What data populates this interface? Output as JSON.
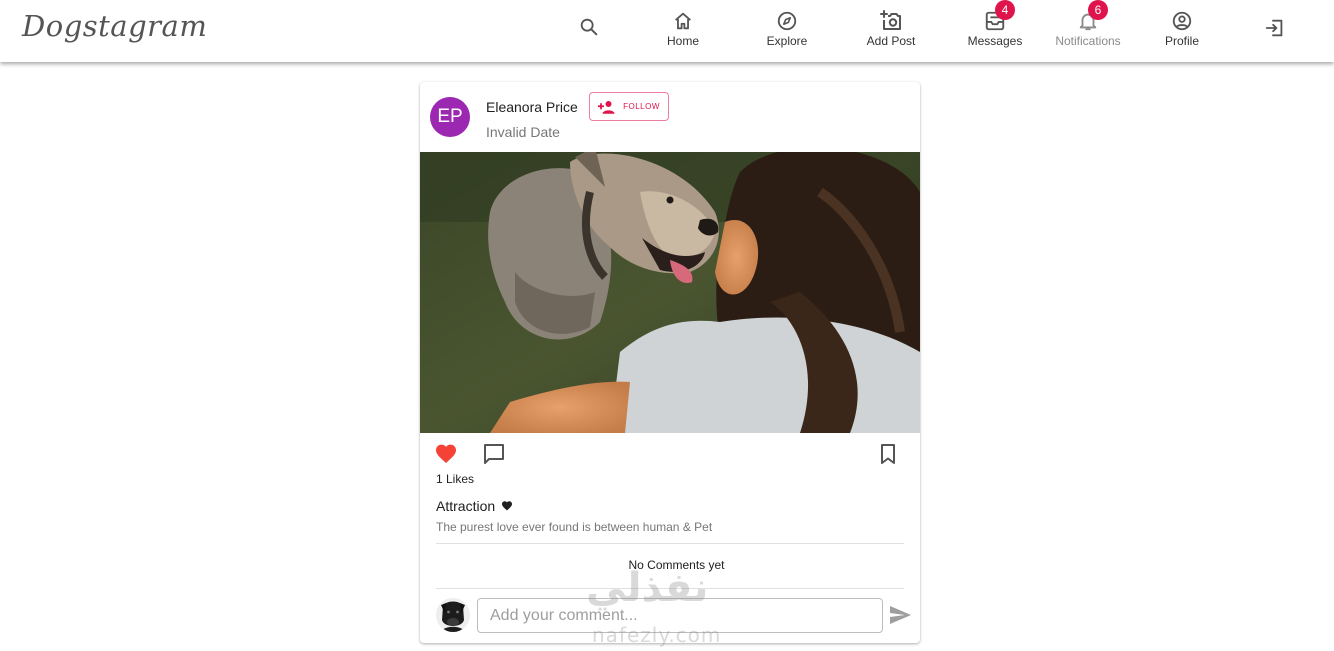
{
  "app": {
    "logo": "Dogstagram"
  },
  "nav": {
    "home": "Home",
    "explore": "Explore",
    "add_post": "Add Post",
    "messages": "Messages",
    "messages_badge": "4",
    "notifications": "Notifications",
    "notifications_badge": "6",
    "profile": "Profile"
  },
  "post": {
    "avatar_initials": "EP",
    "avatar_color": "#9c27b0",
    "author": "Eleanora Price",
    "follow_label": "FOLLOW",
    "date": "Invalid Date",
    "likes": "1 Likes",
    "liked": true,
    "title": "Attraction",
    "caption": "The purest love ever found is between human & Pet",
    "no_comments": "No Comments yet",
    "comment_placeholder": "Add your comment..."
  },
  "watermark": {
    "arabic": "نفذلي",
    "latin": "nafezly.com"
  },
  "colors": {
    "accent": "#e0144c",
    "like": "#f44336",
    "avatar": "#9c27b0"
  }
}
